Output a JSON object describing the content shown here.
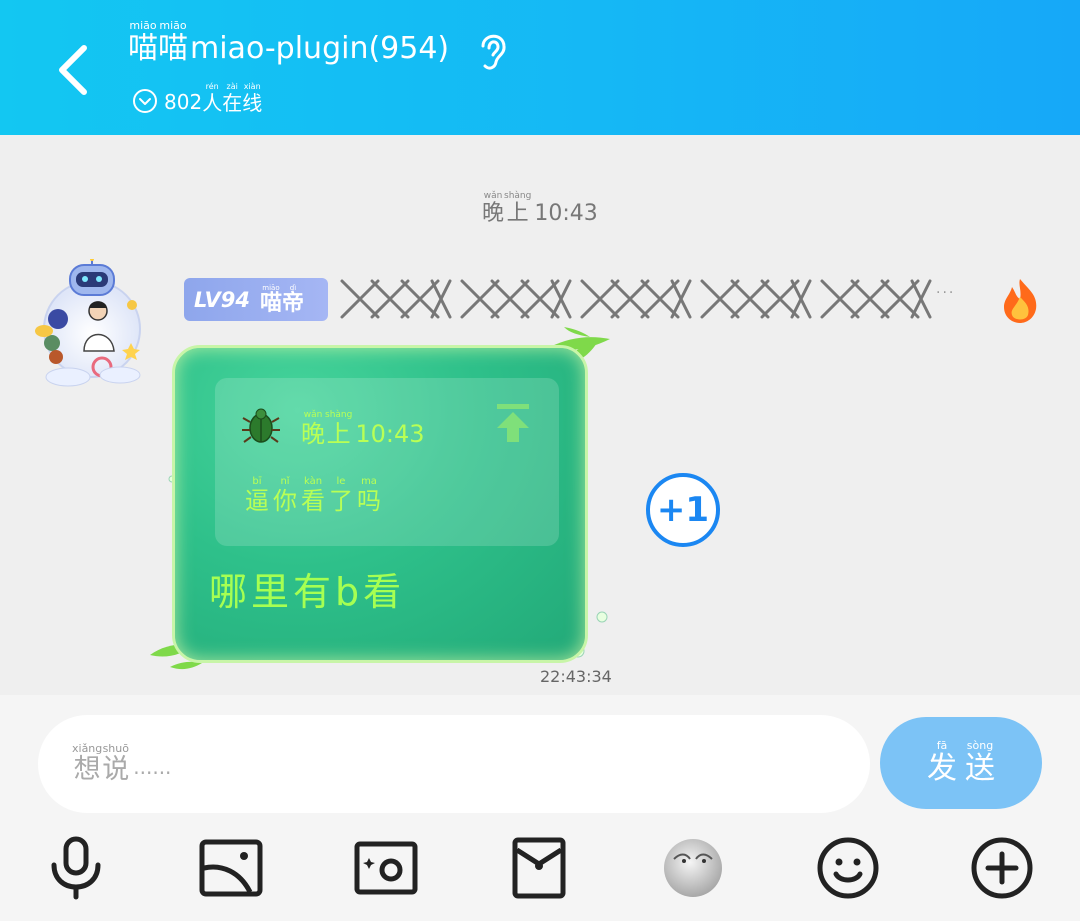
{
  "header": {
    "title_chars": [
      {
        "py": "miāo",
        "ch": "喵"
      },
      {
        "py": "miāo",
        "ch": "喵"
      }
    ],
    "title_latin": "miao-plugin(954)",
    "online_count": "802",
    "online_chars": [
      {
        "py": "rén",
        "ch": "人"
      },
      {
        "py": "zài",
        "ch": "在"
      },
      {
        "py": "xiàn",
        "ch": "线"
      }
    ]
  },
  "chat": {
    "time_separator": {
      "chars": [
        {
          "py": "wǎn",
          "ch": "晚"
        },
        {
          "py": "shàng",
          "ch": "上"
        }
      ],
      "time": "10:43"
    },
    "sender": {
      "level": "LV94",
      "level_name_chars": [
        {
          "py": "miāo",
          "ch": "喵"
        },
        {
          "py": "dì",
          "ch": "帝"
        }
      ],
      "nickname_glyph_groups": 5,
      "more": "···"
    },
    "message": {
      "quote_time_chars": [
        {
          "py": "wǎn",
          "ch": "晚"
        },
        {
          "py": "shàng",
          "ch": "上"
        }
      ],
      "quote_time": "10:43",
      "quote_chars": [
        {
          "py": "bī",
          "ch": "逼"
        },
        {
          "py": "nǐ",
          "ch": "你"
        },
        {
          "py": "kàn",
          "ch": "看"
        },
        {
          "py": "le",
          "ch": "了"
        },
        {
          "py": "ma",
          "ch": "吗"
        }
      ],
      "text": "哪里有b看",
      "timestamp": "22:43:34"
    },
    "plus_one": "+1"
  },
  "input": {
    "placeholder_chars": [
      {
        "py": "xiǎng",
        "ch": "想"
      },
      {
        "py": "shuō",
        "ch": "说"
      }
    ],
    "placeholder_ellipsis": "······",
    "send_chars": [
      {
        "py": "fā",
        "ch": "发"
      },
      {
        "py": "sòng",
        "ch": "送"
      }
    ]
  },
  "toolbar": {
    "items": [
      "microphone-icon",
      "picture-icon",
      "camera-icon",
      "red-packet-icon",
      "sticker-icon",
      "emoji-icon",
      "plus-icon"
    ]
  },
  "colors": {
    "header": "#15b8f5",
    "bubble": "#2ec08a",
    "bubble_text": "#a6ff52",
    "send_button": "#7cc3f6",
    "plus_one": "#1b87f2"
  }
}
